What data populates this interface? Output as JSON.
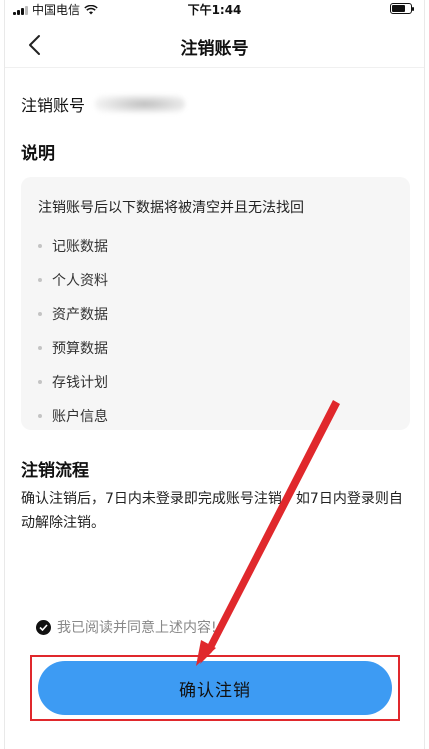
{
  "status_bar": {
    "carrier": "中国电信",
    "time": "下午1:44"
  },
  "nav": {
    "title": "注销账号"
  },
  "account": {
    "label": "注销账号"
  },
  "explanation": {
    "title": "说明",
    "lead": "注销账号后以下数据将被清空并且无法找回",
    "items": [
      "记账数据",
      "个人资料",
      "资产数据",
      "预算数据",
      "存钱计划",
      "账户信息"
    ]
  },
  "process": {
    "title": "注销流程",
    "text": "确认注销后，7日内未登录即完成账号注销，如7日内登录则自动解除注销。"
  },
  "agreement": {
    "label": "我已阅读并同意上述内容!",
    "checked": true
  },
  "confirm_button": {
    "label": "确认注销"
  },
  "colors": {
    "primary_button": "#3d9bf3",
    "annotation_red": "#e0282c"
  }
}
